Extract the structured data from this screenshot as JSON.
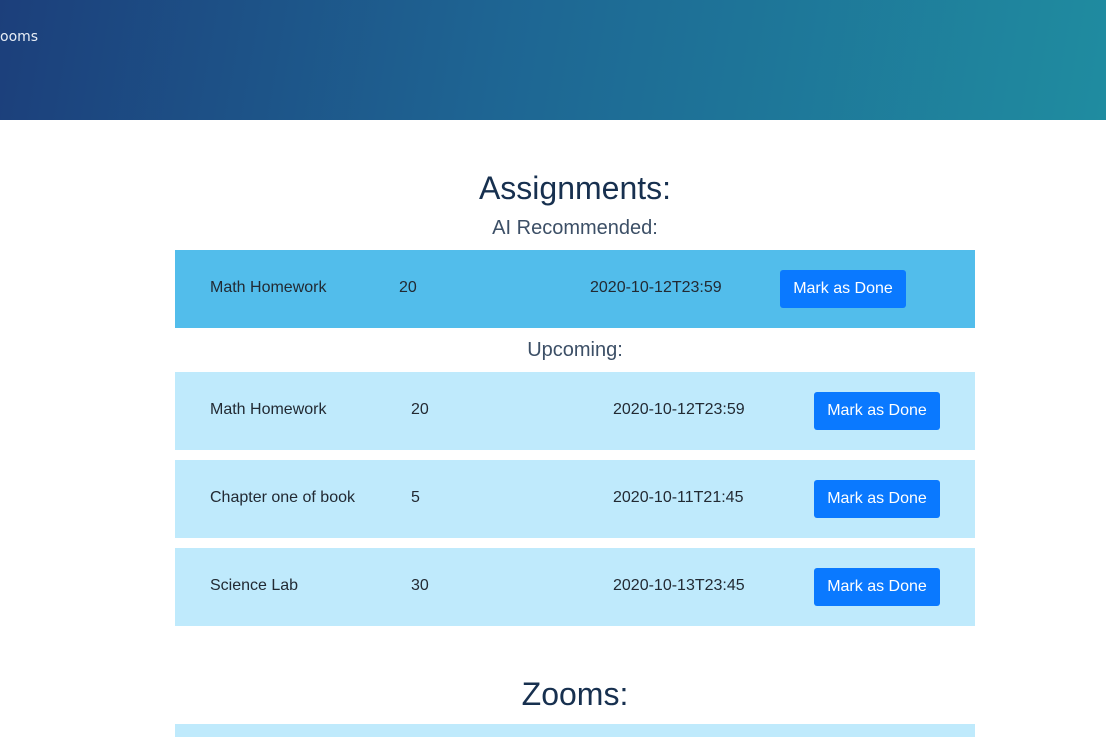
{
  "nav": {
    "zooms_link": "ooms"
  },
  "assignments": {
    "heading": "Assignments:",
    "ai_label": "AI Recommended:",
    "upcoming_label": "Upcoming:",
    "ai_recommended": [
      {
        "name": "Math Homework",
        "points": "20",
        "due": "2020-10-12T23:59",
        "action": "Mark as Done"
      }
    ],
    "upcoming": [
      {
        "name": "Math Homework",
        "points": "20",
        "due": "2020-10-12T23:59",
        "action": "Mark as Done"
      },
      {
        "name": "Chapter one of book",
        "points": "5",
        "due": "2020-10-11T21:45",
        "action": "Mark as Done"
      },
      {
        "name": "Science Lab",
        "points": "30",
        "due": "2020-10-13T23:45",
        "action": "Mark as Done"
      }
    ]
  },
  "zooms": {
    "heading": "Zooms:"
  },
  "colors": {
    "ai_row": "#52bdeb",
    "upcoming_row": "#bfeafc",
    "button": "#0a79ff",
    "heading": "#17304f"
  }
}
